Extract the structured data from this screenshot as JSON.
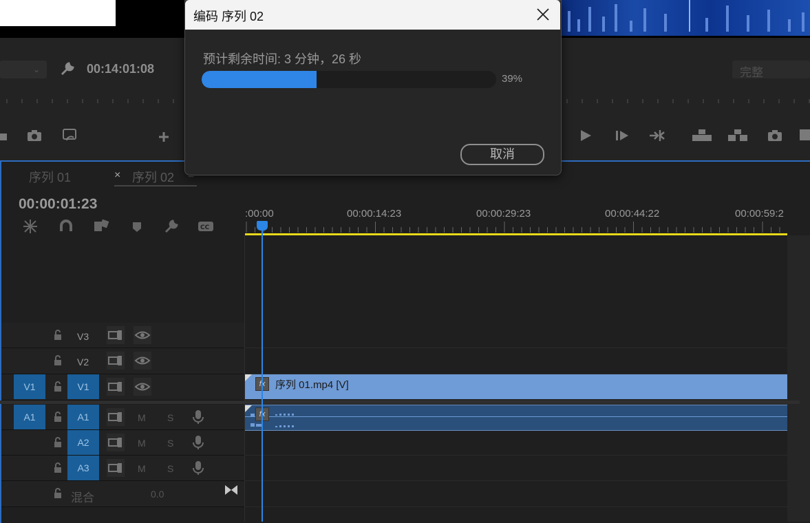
{
  "dialog": {
    "title": "编码 序列 02",
    "eta_text": "预计剩余时间: 3 分钟，26 秒",
    "progress_percent_label": "39%",
    "progress_fraction": 0.39,
    "cancel_label": "取消"
  },
  "program_monitor": {
    "timecode": "00:14:01:08",
    "quality_label": "完整"
  },
  "timeline": {
    "tabs": [
      {
        "label": "序列 01"
      },
      {
        "label": "序列 02"
      }
    ],
    "tab_close_glyph": "×",
    "tab_menu_glyph": "≡",
    "timecode": "00:00:01:23",
    "ruler_labels": [
      ":00:00",
      "00:00:14:23",
      "00:00:29:23",
      "00:00:44:22",
      "00:00:59:2"
    ],
    "tracks": {
      "v3": {
        "label": "V3"
      },
      "v2": {
        "label": "V2"
      },
      "v1": {
        "source": "V1",
        "label": "V1"
      },
      "a1": {
        "source": "A1",
        "label": "A1",
        "m": "M",
        "s": "S"
      },
      "a2": {
        "label": "A2",
        "m": "M",
        "s": "S"
      },
      "a3": {
        "label": "A3",
        "m": "M",
        "s": "S"
      },
      "mix": {
        "label": "混合",
        "value": "0.0"
      }
    },
    "clip_v1_label": "序列 01.mp4 [V]",
    "fx_glyph": "fx"
  },
  "colors": {
    "accent_blue": "#2f86e6",
    "work_area_yellow": "#e8d81a",
    "track_badge_blue": "#1a5f99",
    "video_clip": "#6f9bd6",
    "audio_clip": "#2a4f7a"
  },
  "icons": [
    "wrench-icon",
    "camera-icon",
    "export-frame-icon",
    "plus-icon",
    "play-icon",
    "step-forward-icon",
    "go-to-out-icon",
    "lift-icon",
    "extract-icon",
    "snap-icon",
    "linked-selection-icon",
    "marker-icon",
    "captions-icon",
    "lock-icon",
    "toggle-sync-icon",
    "eye-icon",
    "microphone-icon",
    "close-icon"
  ]
}
